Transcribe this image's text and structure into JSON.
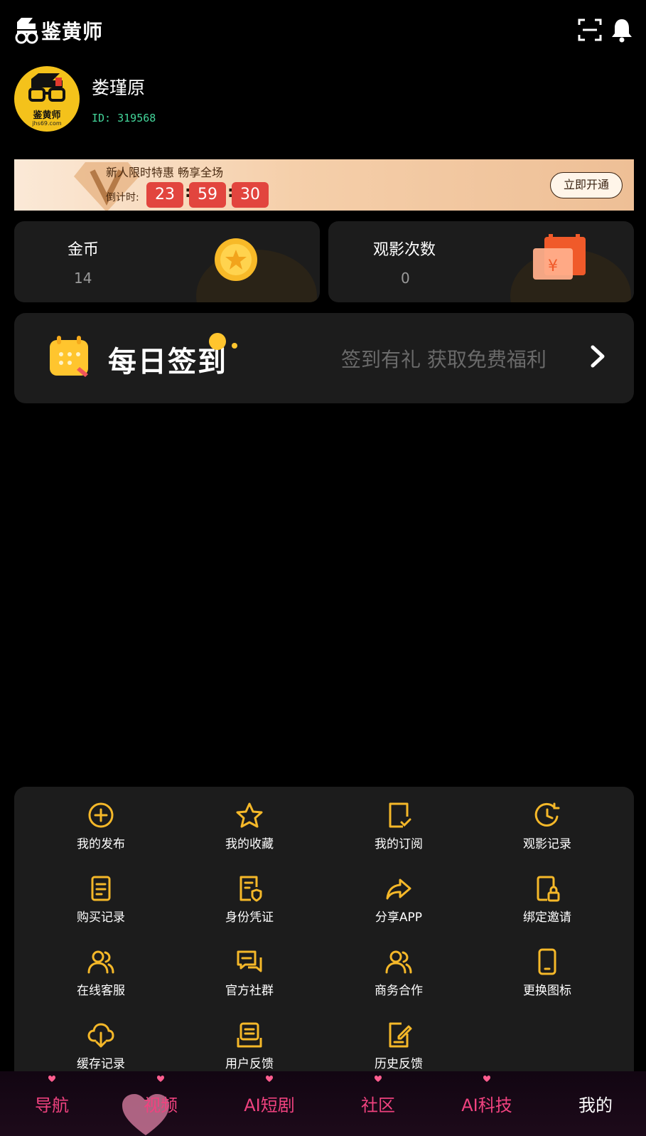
{
  "header": {
    "app_name": "鉴黄师",
    "icons": [
      "scan-icon",
      "bell-icon"
    ]
  },
  "profile": {
    "username": "娄瑾原",
    "id_text": "ID: 319568",
    "avatar_text": "鉴黄师",
    "avatar_subtext": "jhs69.com"
  },
  "vip_banner": {
    "title": "新人限时特惠 畅享全场",
    "countdown_label": "倒计时:",
    "countdown": {
      "hours": "23",
      "minutes": "59",
      "seconds": "30"
    },
    "button_label": "立即开通"
  },
  "stats": {
    "coins": {
      "label": "金币",
      "value": "14",
      "icon": "gold-coin-icon"
    },
    "views": {
      "label": "观影次数",
      "value": "0",
      "icon": "ticket-icon"
    }
  },
  "checkin": {
    "title": "每日签到",
    "subtitle": "签到有礼 获取免费福利",
    "icon": "calendar-icon"
  },
  "menu": {
    "items": [
      {
        "label": "我的发布",
        "icon": "plus-circle-icon"
      },
      {
        "label": "我的收藏",
        "icon": "star-icon"
      },
      {
        "label": "我的订阅",
        "icon": "subscribe-doc-icon"
      },
      {
        "label": "观影记录",
        "icon": "history-clock-icon"
      },
      {
        "label": "购买记录",
        "icon": "receipt-icon"
      },
      {
        "label": "身份凭证",
        "icon": "id-credential-icon"
      },
      {
        "label": "分享APP",
        "icon": "share-arrow-icon"
      },
      {
        "label": "绑定邀请",
        "icon": "phone-lock-icon"
      },
      {
        "label": "在线客服",
        "icon": "users-icon"
      },
      {
        "label": "官方社群",
        "icon": "chat-bubbles-icon"
      },
      {
        "label": "商务合作",
        "icon": "partners-icon"
      },
      {
        "label": "更换图标",
        "icon": "phone-icon"
      },
      {
        "label": "缓存记录",
        "icon": "cloud-download-icon"
      },
      {
        "label": "用户反馈",
        "icon": "feedback-tray-icon"
      },
      {
        "label": "历史反馈",
        "icon": "edit-doc-icon"
      }
    ]
  },
  "bottom_nav": {
    "items": [
      {
        "label": "导航",
        "active": false
      },
      {
        "label": "视频",
        "active": false
      },
      {
        "label": "AI短剧",
        "active": false
      },
      {
        "label": "社区",
        "active": false
      },
      {
        "label": "AI科技",
        "active": false
      },
      {
        "label": "我的",
        "active": true
      }
    ]
  },
  "colors": {
    "accent_gold": "#f5b829",
    "nav_pink": "#f0427f",
    "id_green": "#43d59a",
    "countdown_red": "#e2453e",
    "card_bg": "#1c1c1c"
  }
}
